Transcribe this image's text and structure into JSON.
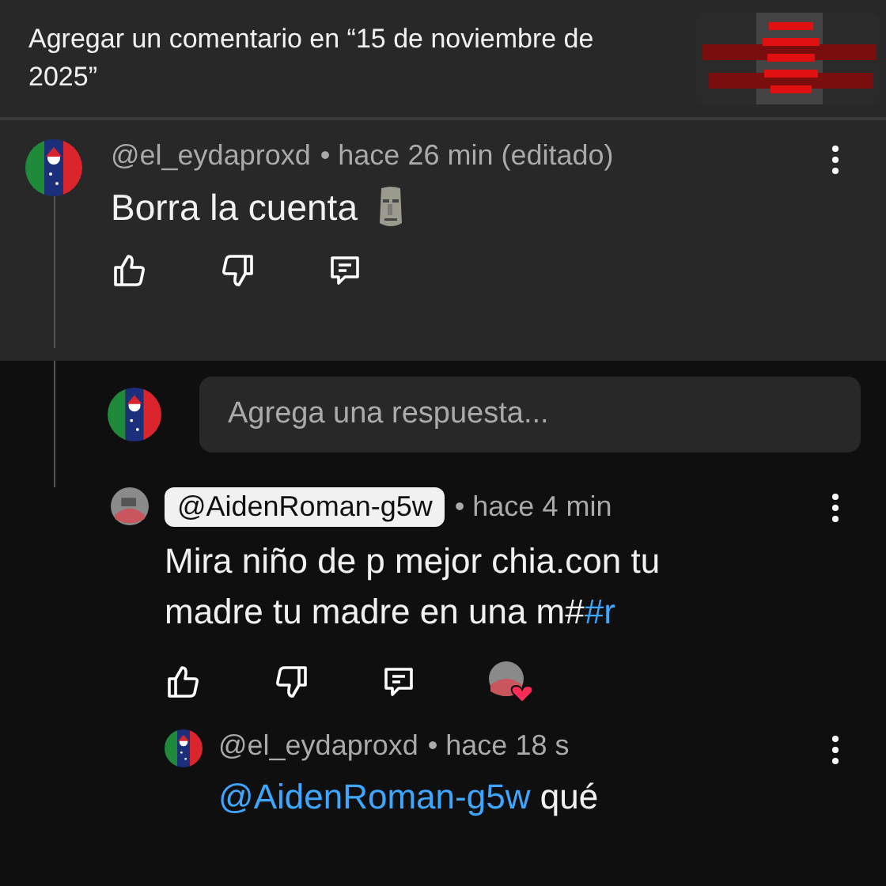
{
  "header": {
    "title": "Agregar un comentario en “15 de noviembre de 2025”"
  },
  "comment": {
    "author": "@el_eydaproxd",
    "time": "• hace 26 min (editado)",
    "text": "Borra la cuenta"
  },
  "reply_box": {
    "placeholder": "Agrega una respuesta..."
  },
  "replies": [
    {
      "author": "@AidenRoman-g5w",
      "author_highlighted": true,
      "time": "• hace 4 min",
      "text": "Mira niño de p mejor chia.con tu madre tu madre en una m#",
      "link": "#r",
      "creator_heart": true
    },
    {
      "author": "@el_eydaproxd",
      "author_highlighted": false,
      "time": "• hace 18 s",
      "mention": "@AidenRoman-g5w",
      "text": "qué"
    }
  ]
}
